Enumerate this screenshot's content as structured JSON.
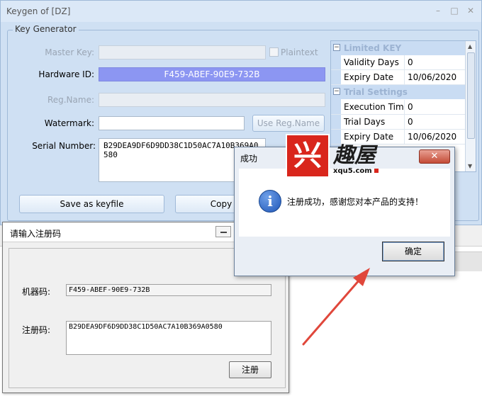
{
  "keygen": {
    "title": "Keygen of [DZ]",
    "controls": {
      "minimize": "–",
      "maximize": "□",
      "close": "✕"
    },
    "group_title": "Key Generator",
    "master_key": {
      "label": "Master Key:",
      "value": ""
    },
    "plaintext": {
      "label": "Plaintext"
    },
    "hardware_id": {
      "label": "Hardware ID:",
      "value": "F459-ABEF-90E9-732B"
    },
    "reg_name": {
      "label": "Reg.Name:",
      "value": ""
    },
    "watermark": {
      "label": "Watermark:",
      "value": ""
    },
    "use_reg_name_button": "Use Reg.Name",
    "serial_number": {
      "label": "Serial Number:",
      "value": "B29DEA9DF6D9DD38C1D50AC7A10B369A0580"
    },
    "save_button": "Save as keyfile",
    "copy_button": "Copy",
    "properties": {
      "limited_key": {
        "title": "Limited KEY",
        "rows": [
          {
            "key": "Validity Days",
            "value": "0"
          },
          {
            "key": "Expiry Date",
            "value": "10/06/2020"
          }
        ]
      },
      "trial_settings": {
        "title": "Trial Settings",
        "rows": [
          {
            "key": "Execution Time",
            "value": "0"
          },
          {
            "key": "Trial Days",
            "value": "0"
          },
          {
            "key": "Expiry Date",
            "value": "10/06/2020"
          }
        ]
      }
    }
  },
  "reg_dialog": {
    "title": "请输入注册码",
    "machine_code": {
      "label": "机器码:",
      "value": "F459-ABEF-90E9-732B"
    },
    "reg_code": {
      "label": "注册码:",
      "value": "B29DEA9DF6D9DD38C1D50AC7A10B369A0580"
    },
    "register_button": "注册"
  },
  "success_dialog": {
    "title": "成功",
    "close": "✕",
    "icon": "info-icon",
    "message": "注册成功，感谢您对本产品的支持！",
    "ok_button": "确定"
  },
  "watermark_logo": {
    "char": "兴",
    "text": "趣屋",
    "url": "xqu5.com"
  },
  "colors": {
    "hardware_id_bg": "#8c96f2",
    "window_bg": "#cfe0f3",
    "arrow": "#e0473b",
    "logo_red": "#d9261c"
  }
}
